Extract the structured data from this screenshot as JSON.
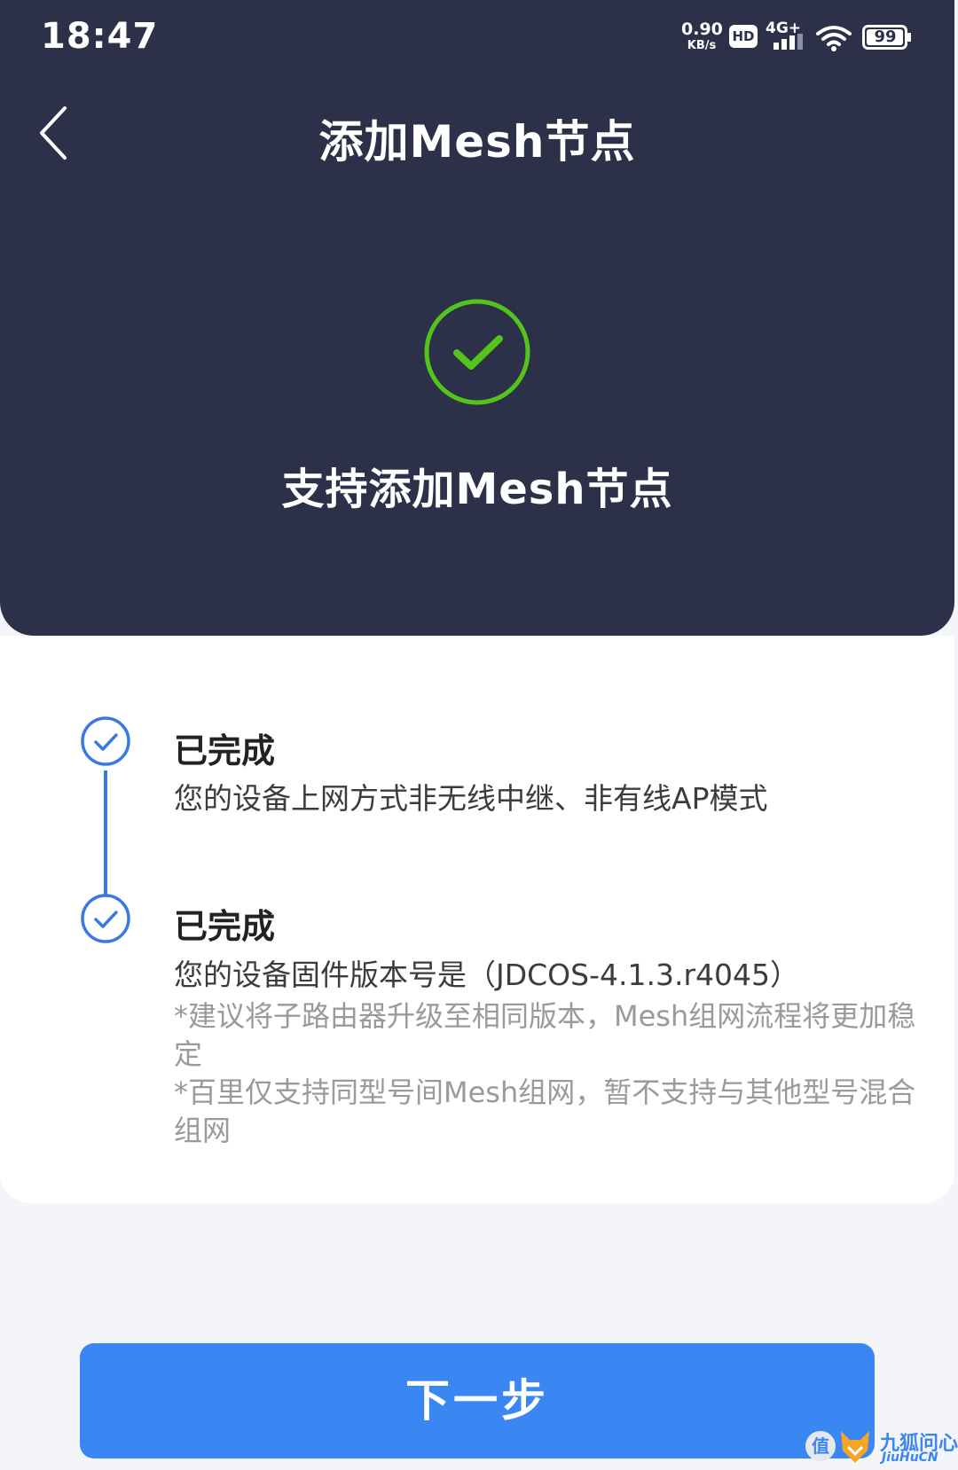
{
  "status_bar": {
    "time": "18:47",
    "speed_value": "0.90",
    "speed_unit": "KB/s",
    "hd_label": "HD",
    "network": "4G+",
    "battery": "99"
  },
  "header": {
    "title": "添加Mesh节点"
  },
  "result": {
    "title": "支持添加Mesh节点",
    "status_color": "#52c41a"
  },
  "steps": [
    {
      "title": "已完成",
      "description": "您的设备上网方式非无线中继、非有线AP模式"
    },
    {
      "title": "已完成",
      "description": "您的设备固件版本号是（JDCOS-4.1.3.r4045）",
      "notes": [
        "*建议将子路由器升级至相同版本，Mesh组网流程将更加稳定",
        "*百里仅支持同型号间Mesh组网，暂不支持与其他型号混合组网"
      ]
    }
  ],
  "footer": {
    "next_label": "下一步"
  },
  "watermark": {
    "badge": "值",
    "name": "九狐问心",
    "name_en": "JiuHuCN"
  },
  "colors": {
    "hero_bg": "#2c3149",
    "accent": "#3a86f2",
    "step_accent": "#3a78e6",
    "success": "#52c41a"
  }
}
